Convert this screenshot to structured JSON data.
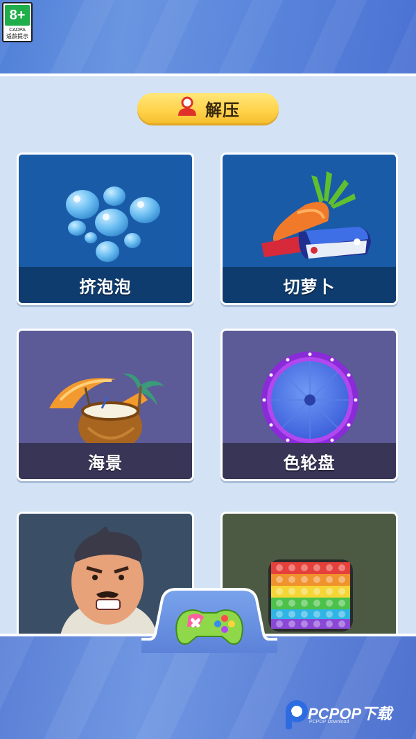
{
  "age_badge": {
    "rating": "8+",
    "org": "CADPA",
    "note": "适龄提示"
  },
  "category": {
    "label": "解压",
    "icon": "user-icon"
  },
  "games": [
    {
      "label": "挤泡泡",
      "icon": "bubbles-icon"
    },
    {
      "label": "切萝卜",
      "icon": "carrot-knife-icon"
    },
    {
      "label": "海景",
      "icon": "coconut-beach-icon"
    },
    {
      "label": "色轮盘",
      "icon": "color-wheel-icon"
    },
    {
      "label": "",
      "icon": "angry-man-icon"
    },
    {
      "label": "",
      "icon": "pop-it-icon"
    }
  ],
  "bottom_nav": {
    "active_icon": "gamepad-icon"
  },
  "watermark": {
    "text": "PCPOP下载",
    "subtext": "PCPOP Download"
  },
  "colors": {
    "header": "#5b86dc",
    "background": "#d3e3f5",
    "pill": "#ffd24a",
    "card_blue": "#1a5ba8",
    "card_purple": "#5d5a98"
  }
}
